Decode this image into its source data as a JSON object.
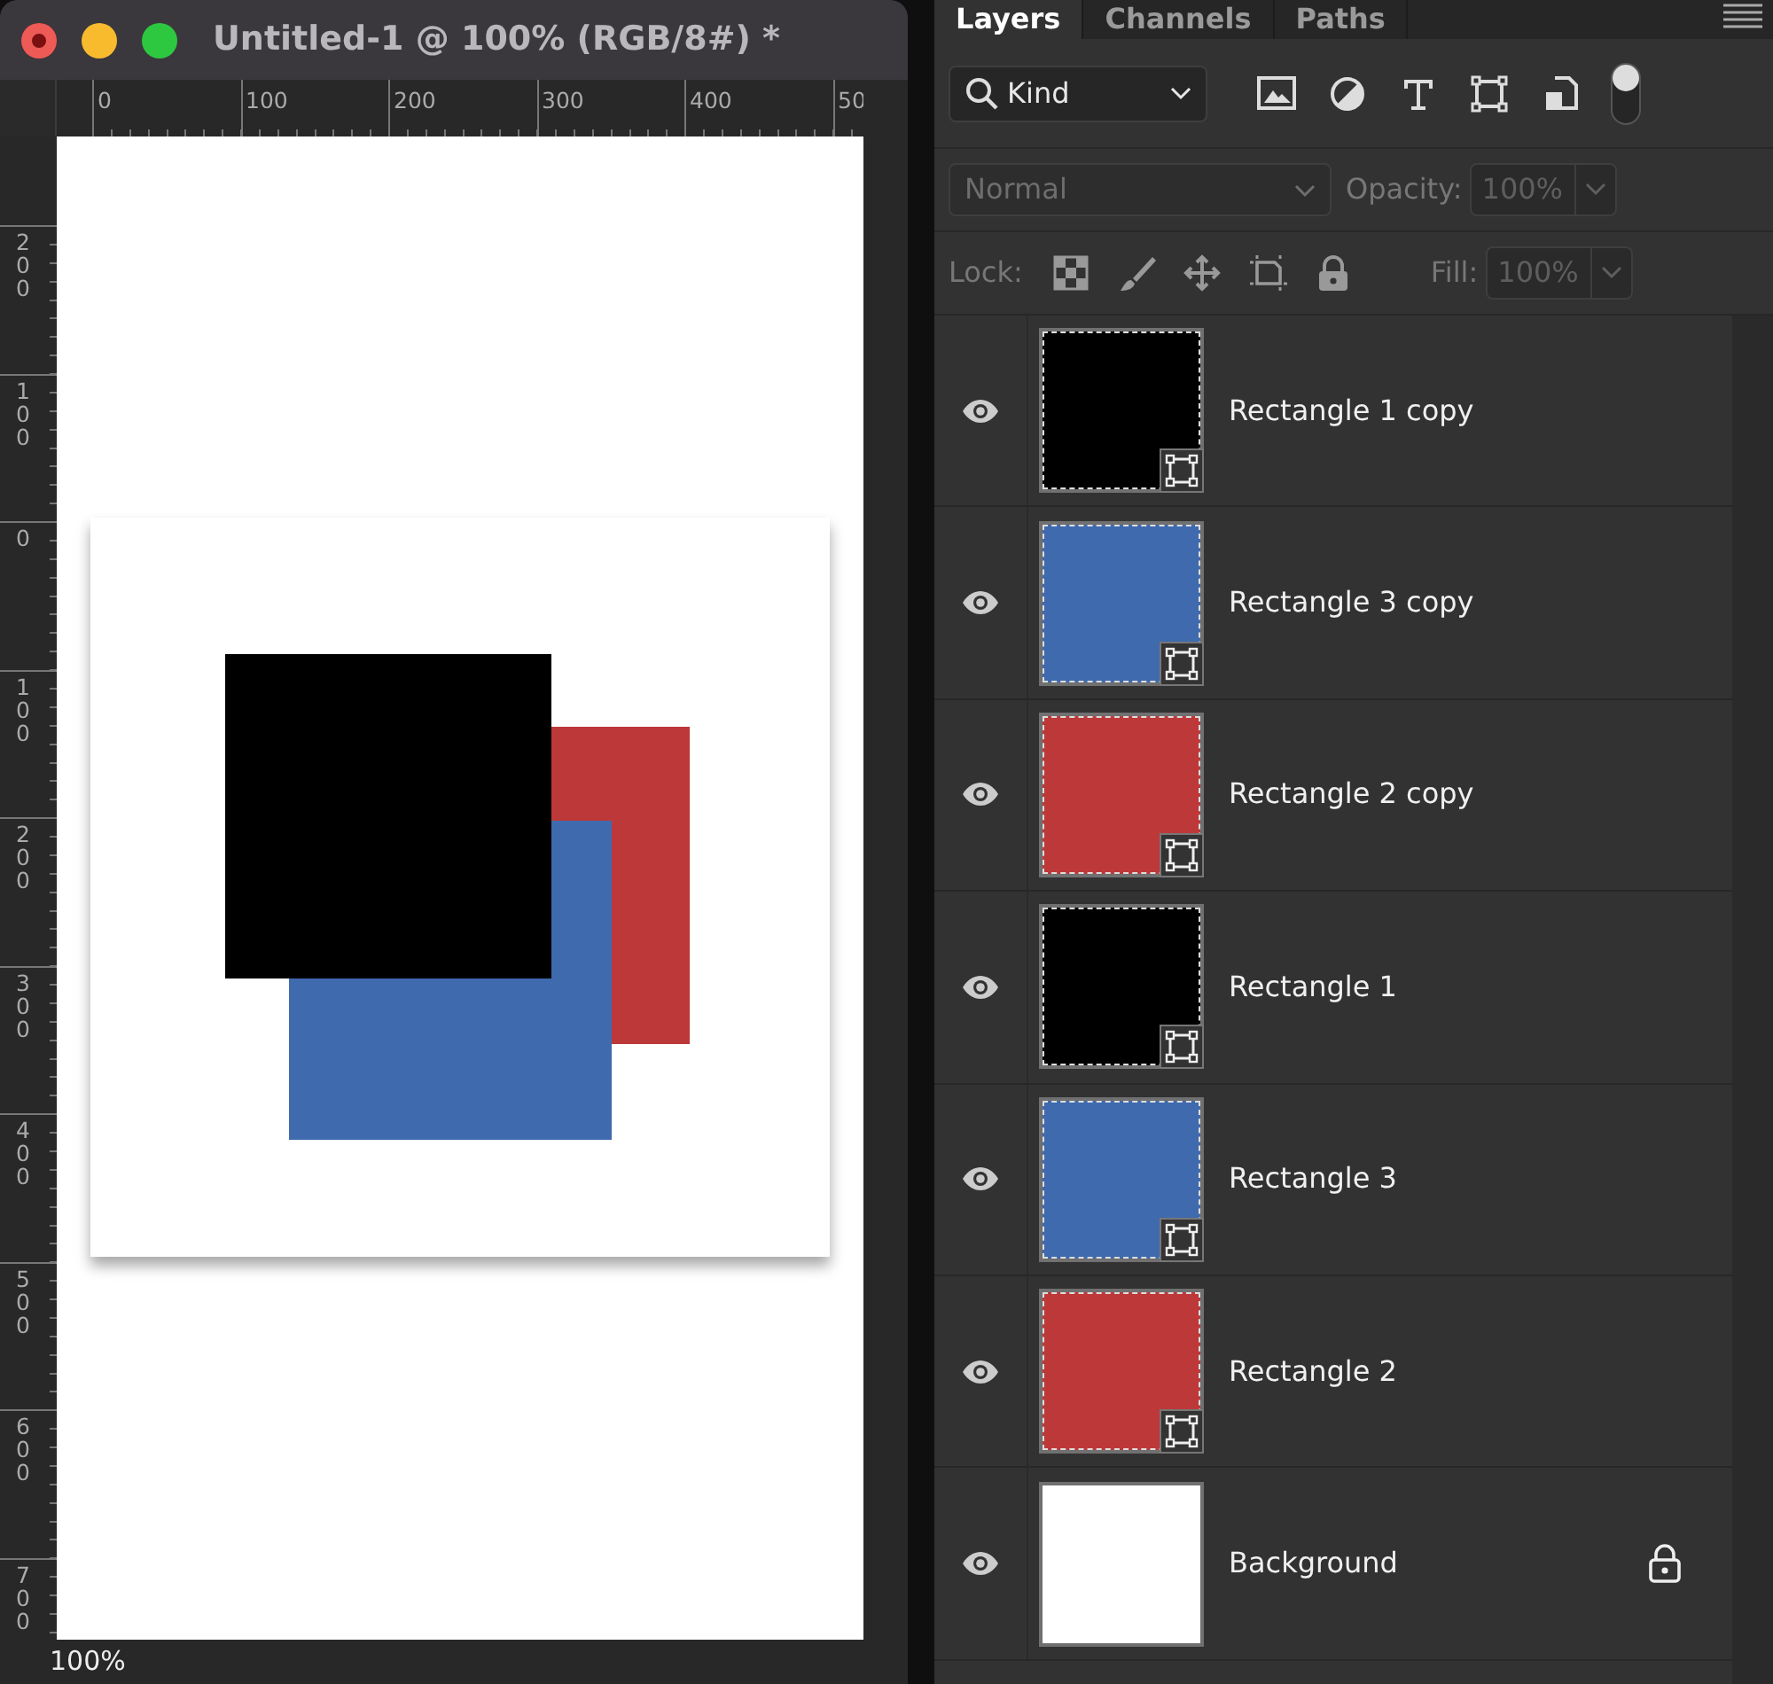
{
  "window": {
    "title": "Untitled-1 @ 100% (RGB/8#) *"
  },
  "rulers": {
    "horizontal": [
      "0",
      "100",
      "200",
      "300",
      "400",
      "50"
    ],
    "vertical": [
      "200",
      "100",
      "0",
      "100",
      "200",
      "300",
      "400",
      "500",
      "600",
      "700"
    ]
  },
  "status_bar": {
    "zoom": "100%"
  },
  "panel": {
    "tabs": [
      {
        "label": "Layers",
        "selected": true
      },
      {
        "label": "Channels",
        "selected": false
      },
      {
        "label": "Paths",
        "selected": false
      }
    ],
    "filter": {
      "value": "Kind"
    },
    "blend_mode": {
      "value": "Normal",
      "disabled": true
    },
    "opacity": {
      "label": "Opacity:",
      "value": "100%",
      "disabled": true
    },
    "lock": {
      "label": "Lock:"
    },
    "fill": {
      "label": "Fill:",
      "value": "100%",
      "disabled": true
    },
    "layers": [
      {
        "name": "Rectangle 1 copy",
        "kind": "shape",
        "color": "#000000",
        "visible": true,
        "locked": false
      },
      {
        "name": "Rectangle 3 copy",
        "kind": "shape",
        "color": "#3f6aae",
        "visible": true,
        "locked": false
      },
      {
        "name": "Rectangle 2 copy",
        "kind": "shape",
        "color": "#bd3839",
        "visible": true,
        "locked": false
      },
      {
        "name": "Rectangle 1",
        "kind": "shape",
        "color": "#000000",
        "visible": true,
        "locked": false
      },
      {
        "name": "Rectangle 3",
        "kind": "shape",
        "color": "#3f6aae",
        "visible": true,
        "locked": false
      },
      {
        "name": "Rectangle 2",
        "kind": "shape",
        "color": "#bd3839",
        "visible": true,
        "locked": false
      },
      {
        "name": "Background",
        "kind": "background",
        "color": "#ffffff",
        "visible": true,
        "locked": true
      }
    ]
  }
}
